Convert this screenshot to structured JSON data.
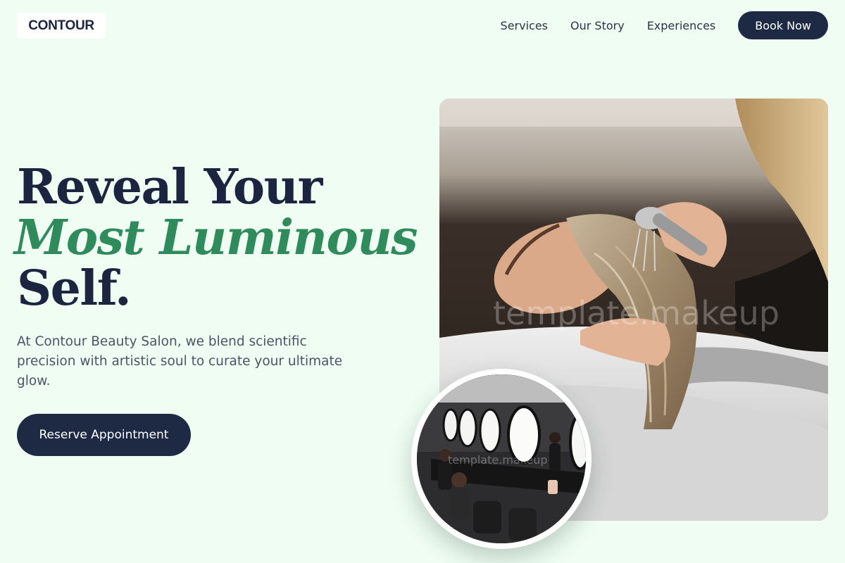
{
  "brand": {
    "logo_text": "CONTOUR"
  },
  "nav": {
    "links": [
      "Services",
      "Our Story",
      "Experiences"
    ],
    "cta_label": "Book Now"
  },
  "hero": {
    "headline_line1": "Reveal Your",
    "headline_accent": "Most Luminous",
    "headline_line3": "Self.",
    "description": "At Contour Beauty Salon, we blend scientific precision with artistic soul to curate your ultimate glow.",
    "cta_label": "Reserve Appointment"
  },
  "images": {
    "main_watermark": "template.makeup",
    "inset_watermark": "template.makeup"
  },
  "colors": {
    "background": "#effdf2",
    "navy": "#1e2a44",
    "accent_green": "#2f8a5c",
    "body_text": "#4a5568"
  }
}
